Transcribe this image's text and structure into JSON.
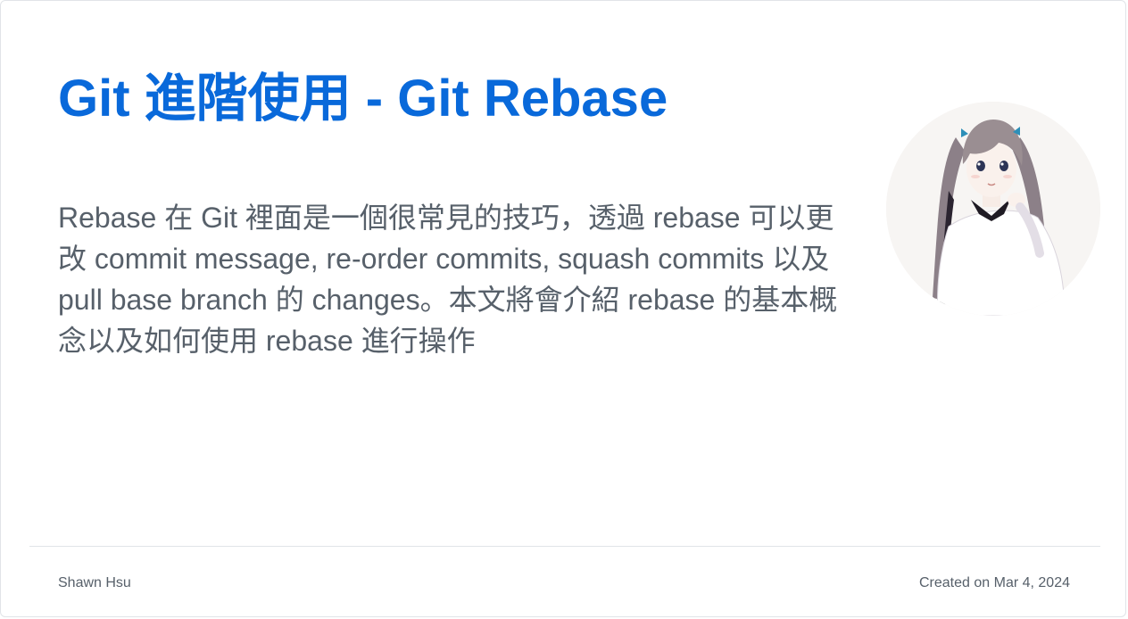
{
  "card": {
    "title": "Git 進階使用 - Git Rebase",
    "description": "Rebase 在 Git 裡面是一個很常見的技巧，透過 rebase 可以更改 commit message, re-order commits, squash commits 以及 pull base branch 的 changes。本文將會介紹 rebase 的基本概念以及如何使用 rebase 進行操作",
    "avatar_icon": "anime-girl-avatar",
    "author": "Shawn Hsu",
    "created": "Created on Mar 4, 2024"
  },
  "colors": {
    "title": "#0969da",
    "text": "#57606a",
    "border": "#e1e4e8"
  }
}
